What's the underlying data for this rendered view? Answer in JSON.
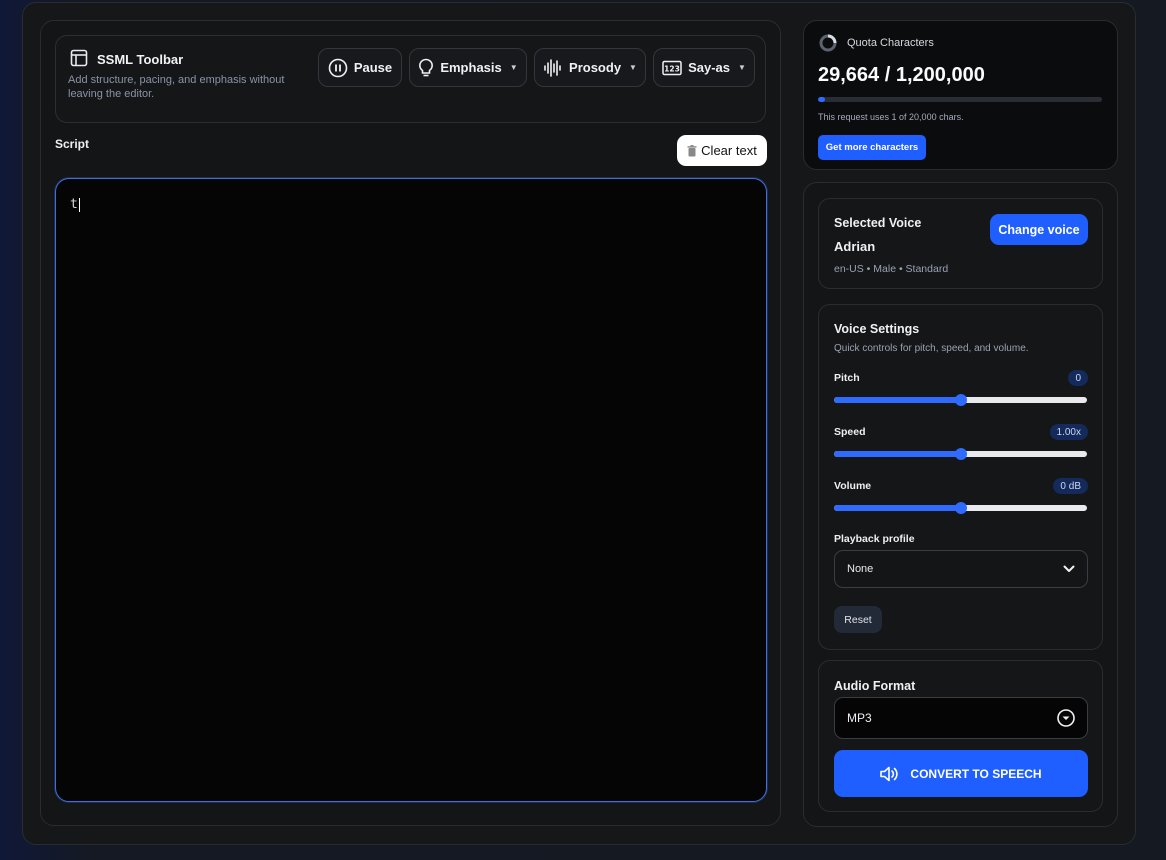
{
  "toolbar": {
    "title": "SSML Toolbar",
    "description": "Add structure, pacing, and emphasis without leaving the editor.",
    "buttons": {
      "pause": "Pause",
      "emphasis": "Emphasis",
      "prosody": "Prosody",
      "say_as": "Say-as"
    }
  },
  "script": {
    "label": "Script",
    "clear_label": "Clear text",
    "value": "t"
  },
  "quota": {
    "label": "Quota Characters",
    "value": "29,664 / 1,200,000",
    "used_fraction": 0.0247,
    "note": "This request uses 1 of 20,000 chars.",
    "button": "Get more characters"
  },
  "voice": {
    "title": "Selected Voice",
    "name": "Adrian",
    "meta": "en-US • Male • Standard",
    "change_label": "Change voice"
  },
  "settings": {
    "title": "Voice Settings",
    "description": "Quick controls for pitch, speed, and volume.",
    "sliders": [
      {
        "label": "Pitch",
        "badge": "0",
        "fraction": 0.5
      },
      {
        "label": "Speed",
        "badge": "1.00x",
        "fraction": 0.5
      },
      {
        "label": "Volume",
        "badge": "0 dB",
        "fraction": 0.5
      }
    ],
    "playback_label": "Playback profile",
    "playback_value": "None",
    "reset_label": "Reset"
  },
  "format": {
    "title": "Audio Format",
    "value": "MP3",
    "convert_label": "CONVERT TO SPEECH"
  },
  "colors": {
    "accent": "#1f5fff",
    "editor_border": "#3d6fe0",
    "background": "#151922"
  }
}
